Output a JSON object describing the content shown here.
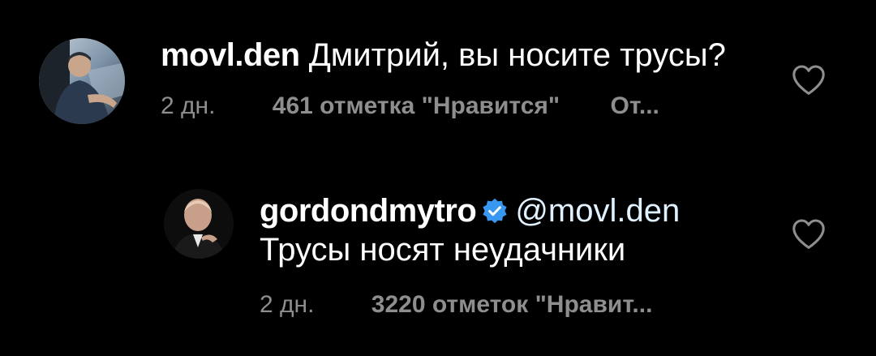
{
  "comments": [
    {
      "username": "movl.den",
      "text": "Дмитрий, вы носите трусы?",
      "time": "2 дн.",
      "likes": "461 отметка \"Нравится\"",
      "reply": "От..."
    }
  ],
  "reply": {
    "username": "gordondmytro",
    "verified": true,
    "mention": "@movl.den",
    "text": "Трусы носят неудачники",
    "time": "2 дн.",
    "likes": "3220 отметок \"Нравит..."
  },
  "colors": {
    "background": "#000000",
    "text": "#ffffff",
    "secondary": "#8e8e8e",
    "mention": "#e0f1ff",
    "verified_badge": "#3897f0"
  },
  "icons": {
    "like": "heart-outline-icon",
    "verified": "verified-badge-icon"
  }
}
